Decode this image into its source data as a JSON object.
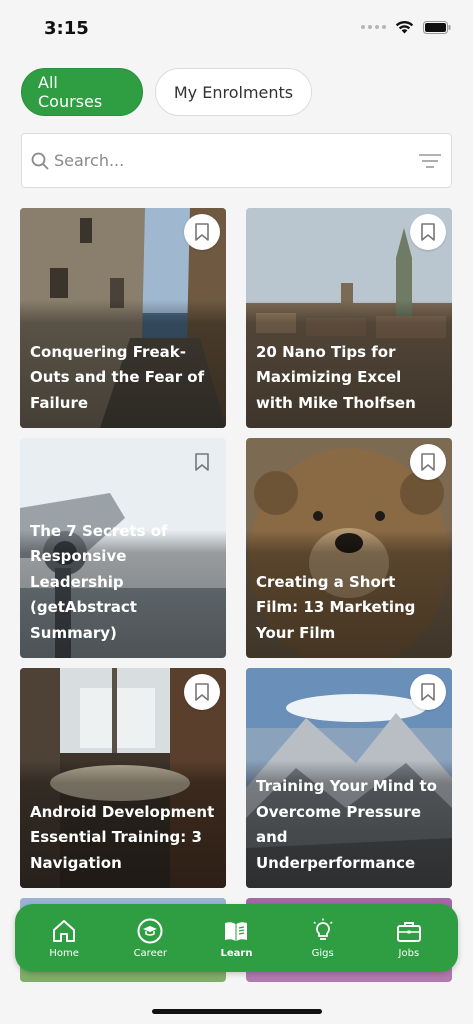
{
  "status_bar": {
    "time": "3:15"
  },
  "segments": [
    {
      "label": "All Courses",
      "active": true
    },
    {
      "label": "My Enrolments",
      "active": false
    }
  ],
  "search": {
    "placeholder": "Search..."
  },
  "courses": [
    {
      "title": "Conquering Freak-Outs and the Fear of Failure"
    },
    {
      "title": "20 Nano Tips for Maximizing Excel with Mike Tholfsen"
    },
    {
      "title": "The 7 Secrets of Responsive Leadership (getAbstract Summary)"
    },
    {
      "title": "Creating a Short Film: 13 Marketing Your Film"
    },
    {
      "title": "Android Development Essential Training: 3 Navigation"
    },
    {
      "title": "Training Your Mind to Overcome Pressure and Underperformance"
    }
  ],
  "tabbar": {
    "items": [
      {
        "label": "Home",
        "icon": "home-icon"
      },
      {
        "label": "Career",
        "icon": "graduation-cap-icon"
      },
      {
        "label": "Learn",
        "icon": "book-icon",
        "active": true
      },
      {
        "label": "Gigs",
        "icon": "lightbulb-icon"
      },
      {
        "label": "Jobs",
        "icon": "briefcase-icon"
      }
    ]
  },
  "colors": {
    "accent": "#2f9e43"
  }
}
